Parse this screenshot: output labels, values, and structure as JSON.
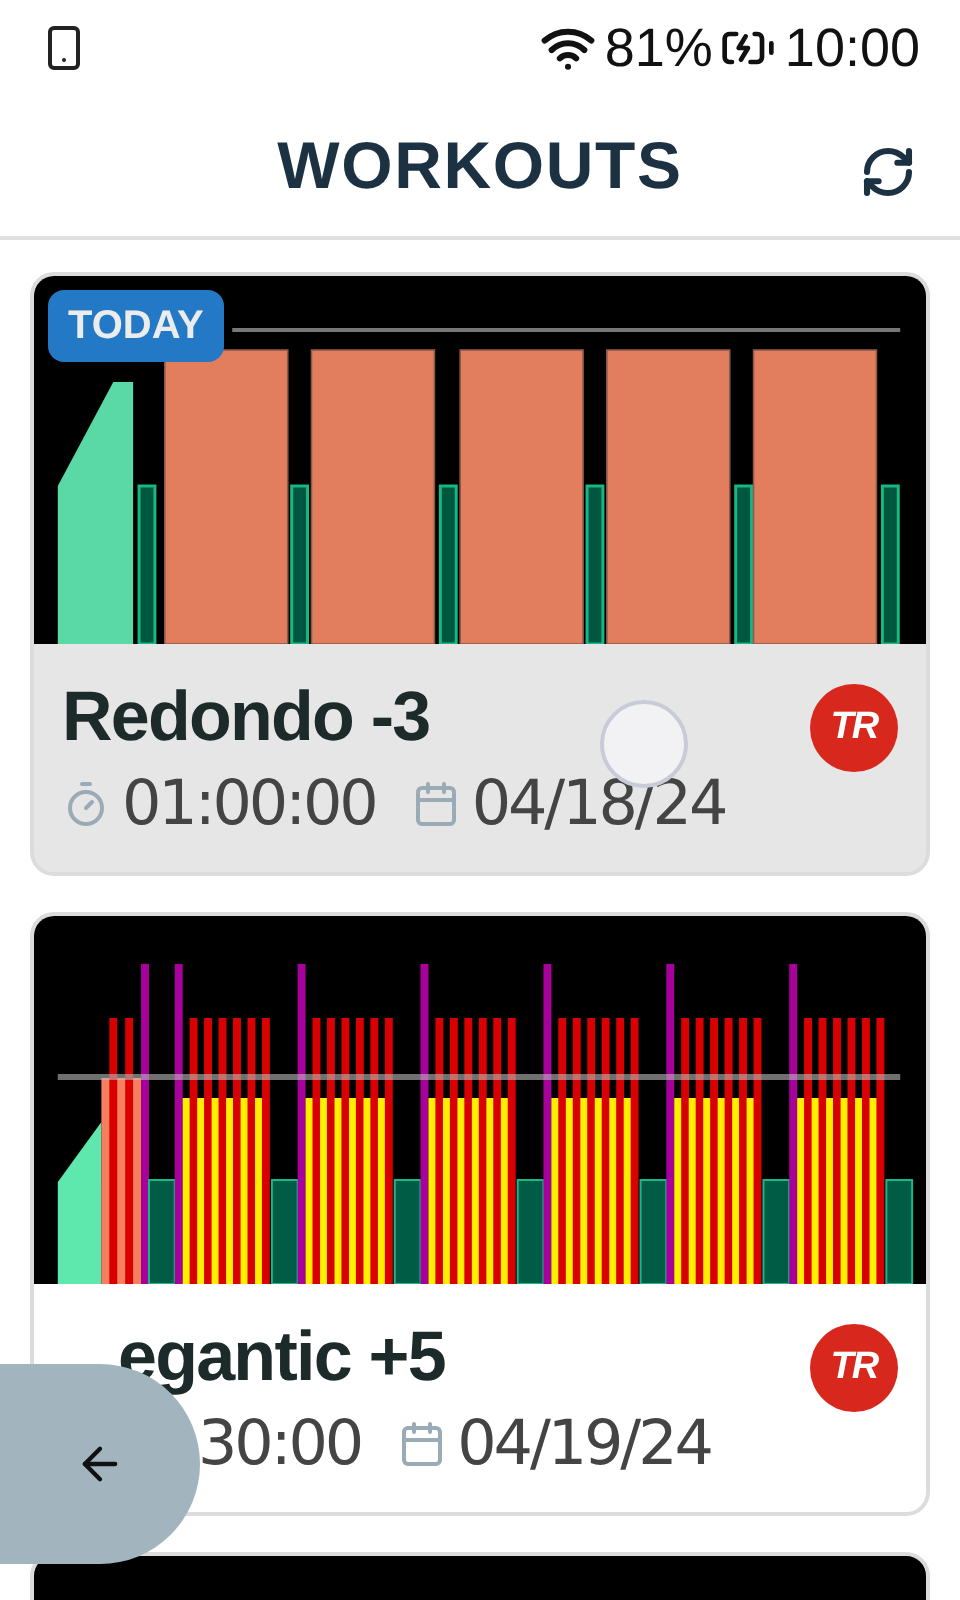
{
  "status_bar": {
    "battery": "81%",
    "time": "10:00"
  },
  "header": {
    "title": "WORKOUTS"
  },
  "workouts": [
    {
      "kind": "threshold",
      "badge": "TODAY",
      "title": "Redondo -3",
      "duration_icon": true,
      "duration": "01:00:00",
      "date": "04/18/24",
      "logo": "TR",
      "pressed": true
    },
    {
      "kind": "microbursts",
      "title": "egantic +5",
      "duration_icon": false,
      "duration": "30:00",
      "date": "04/19/24",
      "logo": "TR",
      "pressed": false
    }
  ]
}
